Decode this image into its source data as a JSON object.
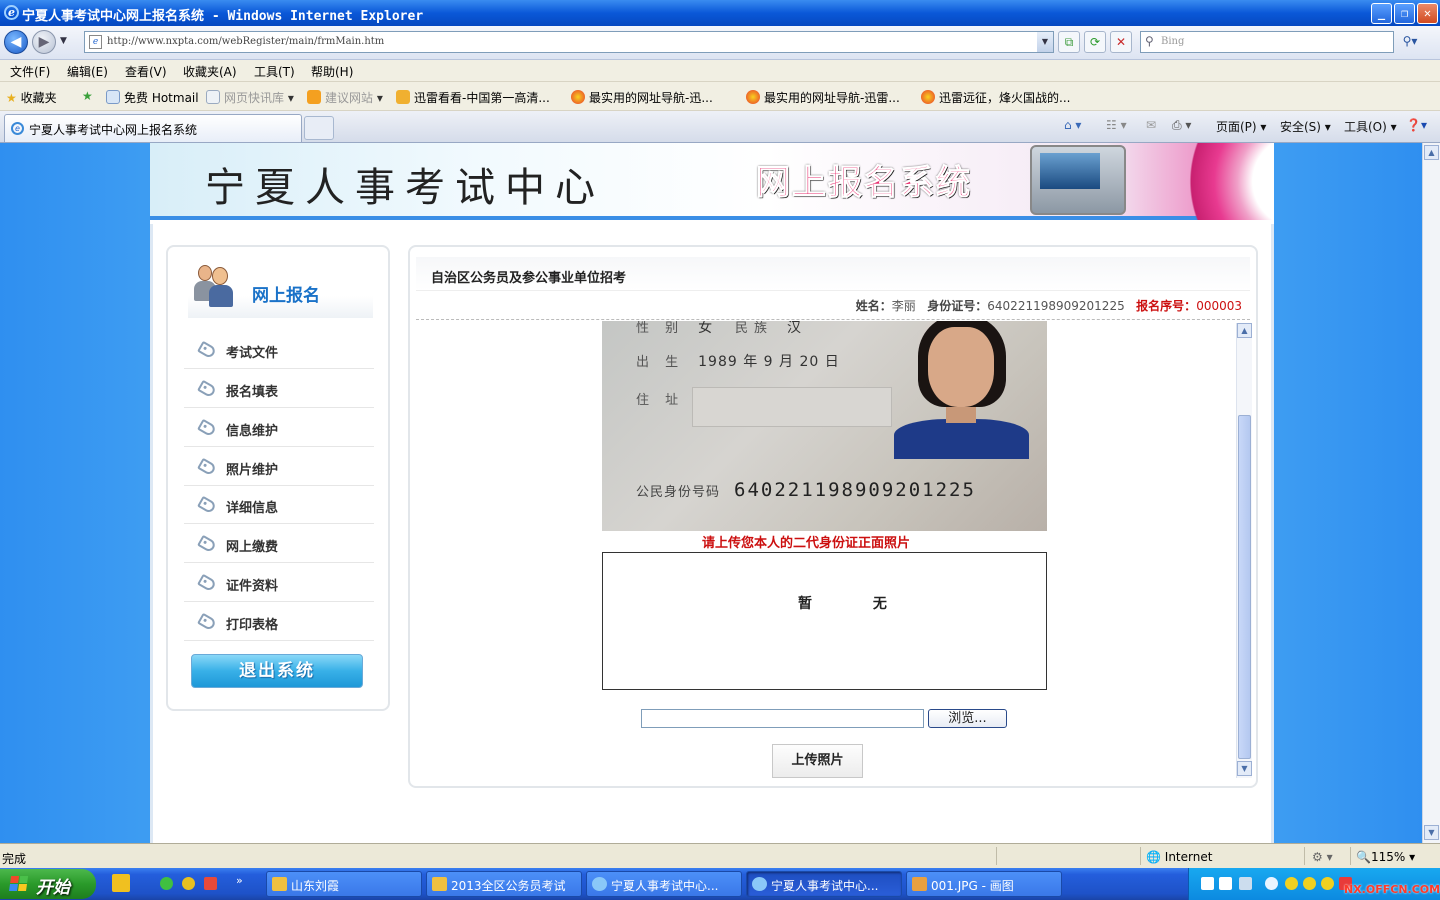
{
  "window": {
    "title": "宁夏人事考试中心网上报名系统 - Windows Internet Explorer",
    "ie_glyph": "e"
  },
  "addressbar": {
    "url": "http://www.nxpta.com/webRegister/main/frmMain.htm",
    "search_placeholder": "Bing"
  },
  "menu": [
    "文件(F)",
    "编辑(E)",
    "查看(V)",
    "收藏夹(A)",
    "工具(T)",
    "帮助(H)"
  ],
  "favorites": {
    "label": "收藏夹",
    "items": [
      "免费 Hotmail",
      "网页快讯库",
      "建议网站",
      "迅雷看看-中国第一高清...",
      "最实用的网址导航-迅...",
      "最实用的网址导航-迅雷...",
      "迅雷远征，烽火国战的..."
    ]
  },
  "tabs": {
    "active": "宁夏人事考试中心网上报名系统"
  },
  "commandbar": {
    "page": "页面(P)",
    "safety": "安全(S)",
    "tools": "工具(O)"
  },
  "banner": {
    "center_name": "宁夏人事考试中心",
    "system_name": "网上报名系统"
  },
  "sidebar": {
    "title": "网上报名",
    "items": [
      "考试文件",
      "报名填表",
      "信息维护",
      "照片维护",
      "详细信息",
      "网上缴费",
      "证件资料",
      "打印表格"
    ],
    "logout": "退出系统"
  },
  "main": {
    "title": "自治区公务员及参公事业单位招考",
    "name_label": "姓名：",
    "name_value": "李丽",
    "id_label": "身份证号：",
    "id_value": "640221198909201225",
    "seq_label": "报名序号：",
    "seq_value": "000003",
    "idcard": {
      "sex_label": "性 别",
      "sex_value": "女",
      "ethnic_label": "民族",
      "ethnic_value": "汉",
      "birth_label": "出 生",
      "birth_value": "1989 年 9 月 20 日",
      "address_label": "住 址",
      "number_label": "公民身份号码",
      "number_value": "640221198909201225"
    },
    "upload_hint": "请上传您本人的二代身份证正面照片",
    "preview_text": "暂 无",
    "browse_label": "浏览...",
    "upload_label": "上传照片"
  },
  "status": {
    "left": "完成",
    "zone": "Internet",
    "zoom": "115%"
  },
  "taskbar": {
    "start": "开始",
    "windows": [
      "山东刘霞",
      "2013全区公务员考试",
      "宁夏人事考试中心...",
      "宁夏人事考试中心...",
      "001.JPG - 画图"
    ]
  },
  "watermark": "NX.OFFCN.COM",
  "colors": {
    "accent_red": "#cc1010",
    "link_blue": "#1a72c8",
    "page_bg_blue": "#3d9cf2"
  }
}
